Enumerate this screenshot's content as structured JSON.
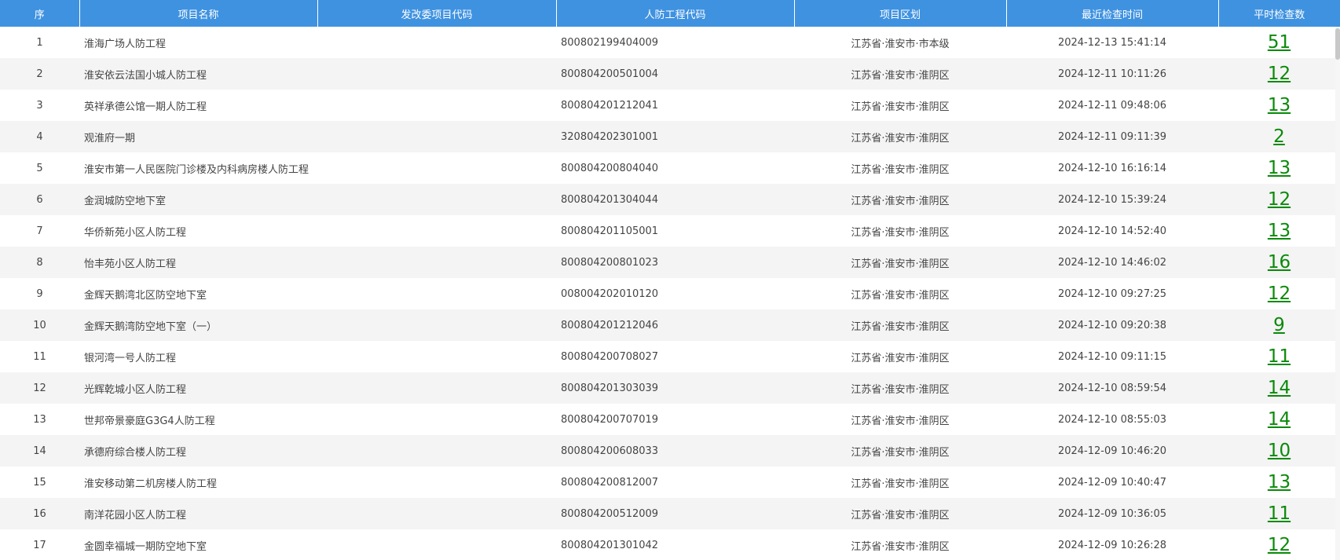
{
  "table": {
    "columns": [
      "序",
      "项目名称",
      "发改委项目代码",
      "人防工程代码",
      "项目区划",
      "最近检查时间",
      "平时检查数"
    ],
    "rows": [
      {
        "idx": "1",
        "name": "淮海广场人防工程",
        "ndrc_code": "",
        "cd_code": "800802199404009",
        "region": "江苏省·淮安市·市本级",
        "time": "2024-12-13 15:41:14",
        "count": "51"
      },
      {
        "idx": "2",
        "name": "淮安依云法国小城人防工程",
        "ndrc_code": "",
        "cd_code": "800804200501004",
        "region": "江苏省·淮安市·淮阴区",
        "time": "2024-12-11 10:11:26",
        "count": "12"
      },
      {
        "idx": "3",
        "name": "英祥承德公馆一期人防工程",
        "ndrc_code": "",
        "cd_code": "800804201212041",
        "region": "江苏省·淮安市·淮阴区",
        "time": "2024-12-11 09:48:06",
        "count": "13"
      },
      {
        "idx": "4",
        "name": "观淮府一期",
        "ndrc_code": "",
        "cd_code": "320804202301001",
        "region": "江苏省·淮安市·淮阴区",
        "time": "2024-12-11 09:11:39",
        "count": "2"
      },
      {
        "idx": "5",
        "name": "淮安市第一人民医院门诊楼及内科病房楼人防工程",
        "ndrc_code": "",
        "cd_code": "800804200804040",
        "region": "江苏省·淮安市·淮阴区",
        "time": "2024-12-10 16:16:14",
        "count": "13"
      },
      {
        "idx": "6",
        "name": "金润城防空地下室",
        "ndrc_code": "",
        "cd_code": "800804201304044",
        "region": "江苏省·淮安市·淮阴区",
        "time": "2024-12-10 15:39:24",
        "count": "12"
      },
      {
        "idx": "7",
        "name": "华侨新苑小区人防工程",
        "ndrc_code": "",
        "cd_code": "800804201105001",
        "region": "江苏省·淮安市·淮阴区",
        "time": "2024-12-10 14:52:40",
        "count": "13"
      },
      {
        "idx": "8",
        "name": "怡丰苑小区人防工程",
        "ndrc_code": "",
        "cd_code": "800804200801023",
        "region": "江苏省·淮安市·淮阴区",
        "time": "2024-12-10 14:46:02",
        "count": "16"
      },
      {
        "idx": "9",
        "name": "金辉天鹅湾北区防空地下室",
        "ndrc_code": "",
        "cd_code": "008004202010120",
        "region": "江苏省·淮安市·淮阴区",
        "time": "2024-12-10 09:27:25",
        "count": "12"
      },
      {
        "idx": "10",
        "name": "金辉天鹅湾防空地下室（一）",
        "ndrc_code": "",
        "cd_code": "800804201212046",
        "region": "江苏省·淮安市·淮阴区",
        "time": "2024-12-10 09:20:38",
        "count": "9"
      },
      {
        "idx": "11",
        "name": "银河湾一号人防工程",
        "ndrc_code": "",
        "cd_code": "800804200708027",
        "region": "江苏省·淮安市·淮阴区",
        "time": "2024-12-10 09:11:15",
        "count": "11"
      },
      {
        "idx": "12",
        "name": "光辉乾城小区人防工程",
        "ndrc_code": "",
        "cd_code": "800804201303039",
        "region": "江苏省·淮安市·淮阴区",
        "time": "2024-12-10 08:59:54",
        "count": "14"
      },
      {
        "idx": "13",
        "name": "世邦帝景豪庭G3G4人防工程",
        "ndrc_code": "",
        "cd_code": "800804200707019",
        "region": "江苏省·淮安市·淮阴区",
        "time": "2024-12-10 08:55:03",
        "count": "14"
      },
      {
        "idx": "14",
        "name": "承德府综合楼人防工程",
        "ndrc_code": "",
        "cd_code": "800804200608033",
        "region": "江苏省·淮安市·淮阴区",
        "time": "2024-12-09 10:46:20",
        "count": "10"
      },
      {
        "idx": "15",
        "name": "淮安移动第二机房楼人防工程",
        "ndrc_code": "",
        "cd_code": "800804200812007",
        "region": "江苏省·淮安市·淮阴区",
        "time": "2024-12-09 10:40:47",
        "count": "13"
      },
      {
        "idx": "16",
        "name": "南洋花园小区人防工程",
        "ndrc_code": "",
        "cd_code": "800804200512009",
        "region": "江苏省·淮安市·淮阴区",
        "time": "2024-12-09 10:36:05",
        "count": "11"
      },
      {
        "idx": "17",
        "name": "金圆幸福城一期防空地下室",
        "ndrc_code": "",
        "cd_code": "800804201301042",
        "region": "江苏省·淮安市·淮阴区",
        "time": "2024-12-09 10:26:28",
        "count": "12"
      }
    ]
  },
  "colors": {
    "header_bg": "#3f92e0",
    "header_text": "#ffffff",
    "row_alt_bg": "#f4f4f4",
    "count_link": "#0a8a0a",
    "body_text": "#444444"
  }
}
